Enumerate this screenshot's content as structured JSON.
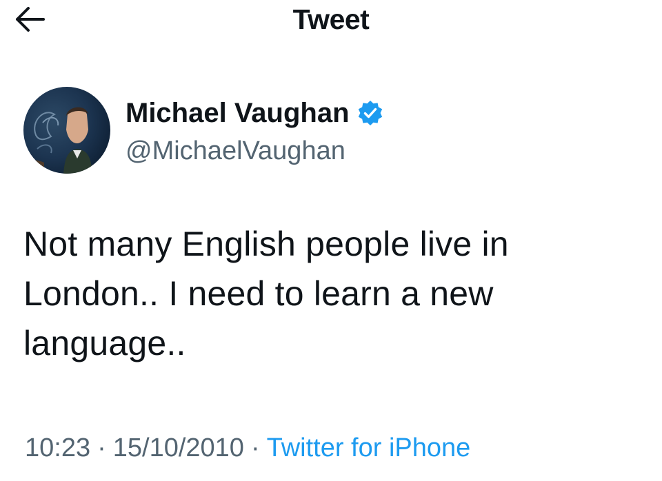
{
  "header": {
    "title": "Tweet",
    "back_icon": "arrow-left-icon"
  },
  "author": {
    "display_name": "Michael Vaughan",
    "handle": "@MichaelVaughan",
    "verified": true,
    "verified_color": "#1d9bf0"
  },
  "tweet": {
    "text": "Not many English people live in\nLondon.. I need to learn a new\nlanguage.."
  },
  "meta": {
    "time": "10:23",
    "separator": "·",
    "date": "15/10/2010",
    "source": "Twitter for iPhone"
  },
  "colors": {
    "text": "#0f1419",
    "secondary": "#536471",
    "link": "#1d9bf0"
  }
}
